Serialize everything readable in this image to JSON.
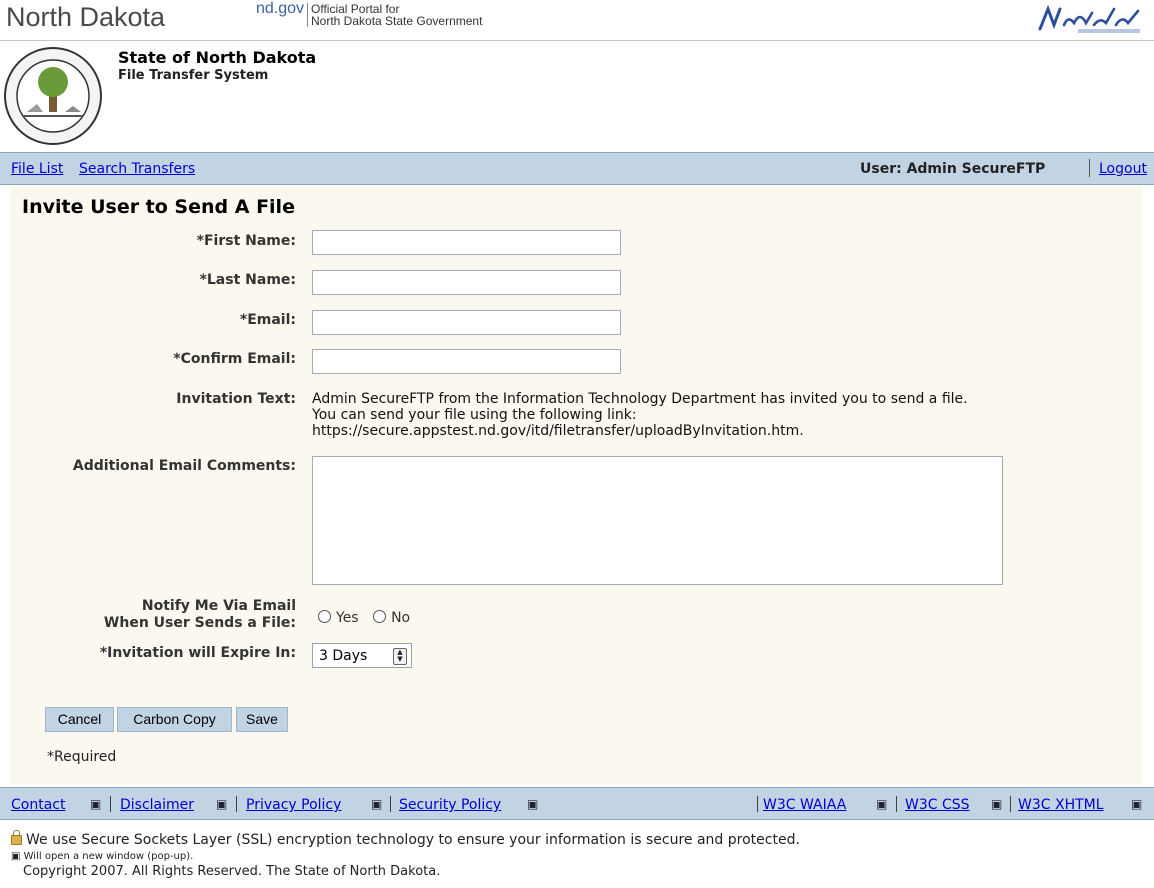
{
  "header": {
    "state_title": "North Dakota",
    "ndgov": "nd.gov",
    "portal_line1": "Official Portal for",
    "portal_line2": "North Dakota State Government",
    "state_name": "State of North Dakota",
    "system_name": "File Transfer System"
  },
  "nav": {
    "file_list": "File List",
    "search_transfers": "Search Transfers",
    "user_label": "User: Admin SecureFTP",
    "logout": "Logout"
  },
  "form": {
    "title": "Invite User to Send A File",
    "first_name_label": "*First Name:",
    "first_name_value": "",
    "last_name_label": "*Last Name:",
    "last_name_value": "",
    "email_label": "*Email:",
    "email_value": "",
    "confirm_email_label": "*Confirm Email:",
    "confirm_email_value": "",
    "invitation_text_label": "Invitation Text:",
    "invitation_text": [
      "Admin SecureFTP from the Information Technology Department has invited you to send a file.",
      "You can send your file using the following link:",
      "https://secure.appstest.nd.gov/itd/filetransfer/uploadByInvitation.htm."
    ],
    "comments_label": "Additional Email Comments:",
    "comments_value": "",
    "notify_label_line1": "Notify Me Via Email",
    "notify_label_line2": "When User Sends a File:",
    "notify_options": [
      "Yes",
      "No"
    ],
    "expire_label": "*Invitation will Expire In:",
    "expire_selected": "3 Days",
    "buttons": {
      "cancel": "Cancel",
      "carbon_copy": "Carbon Copy",
      "save": "Save"
    },
    "required_note": "*Required"
  },
  "footer": {
    "links_left": [
      "Contact",
      "Disclaimer",
      "Privacy Policy",
      "Security Policy"
    ],
    "links_right": [
      "W3C WAIAA",
      "W3C CSS",
      "W3C XHTML"
    ],
    "ssl_text": "We use Secure Sockets Layer (SSL) encryption technology to ensure your information is secure and protected.",
    "popup_note": "Will open a new window (pop-up).",
    "copyright": "Copyright 2007. All Rights Reserved. The State of North Dakota."
  },
  "icons": {
    "seal": "state-seal-icon",
    "logo": "north-dakota-legendary-logo",
    "popup": "popup-window-icon",
    "lock": "lock-icon"
  },
  "colors": {
    "nav_bar": "#c2d3e4",
    "panel_bg": "#fbf8ef",
    "link": "#0000cc",
    "ndgov_blue": "#3a62a8"
  }
}
